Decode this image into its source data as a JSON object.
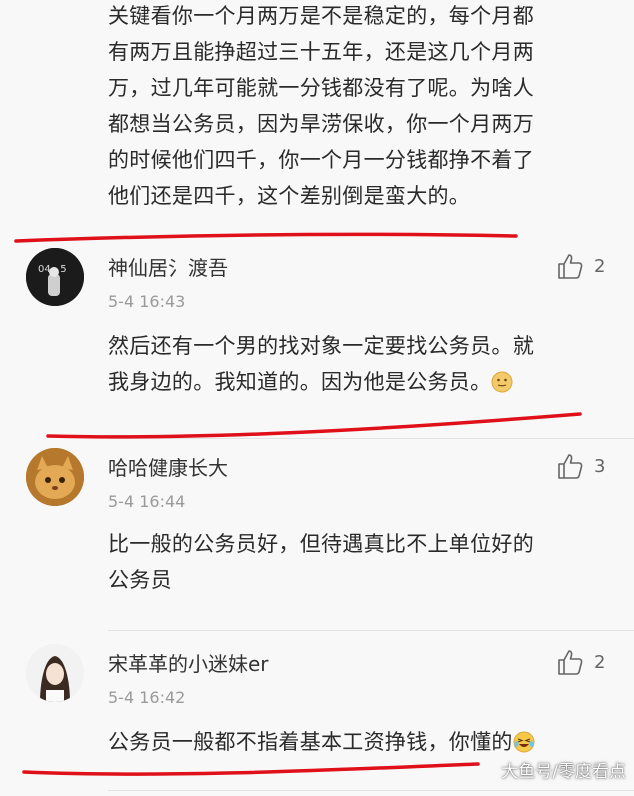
{
  "prev_comment": {
    "lines": [
      "关键看你一个月两万是不是稳定的，每个月都",
      "有两万且能挣超过三十五年，还是这几个月两",
      "万，过几年可能就一分钱都没有了呢。为啥人",
      "都想当公务员，因为旱涝保收，你一个月两万",
      "的时候他们四千，你一个月一分钱都挣不着了",
      "他们还是四千，这个差别倒是蛮大的。"
    ]
  },
  "comments": [
    {
      "username": "神仙居氵渡吾",
      "time": "5-4 16:43",
      "likes": "2",
      "lines": [
        "然后还有一个男的找对象一定要找公务员。就",
        "我身边的。我知道的。因为他是公务员。"
      ],
      "avatar_icon": "dark-photo-avatar",
      "emoji_icon": "smile-emoji-icon"
    },
    {
      "username": "哈哈健康长大",
      "time": "5-4 16:44",
      "likes": "3",
      "lines": [
        "比一般的公务员好，但待遇真比不上单位好的",
        "公务员"
      ],
      "avatar_icon": "cat-avatar"
    },
    {
      "username": "宋革革的小迷妹er",
      "time": "5-4 16:42",
      "likes": "2",
      "lines": [
        "公务员一般都不指着基本工资挣钱，你懂的"
      ],
      "avatar_icon": "girl-avatar",
      "emoji_icon": "laugh-cry-emoji-icon"
    }
  ],
  "watermark": "大鱼号/零度看点",
  "colors": {
    "background": "#f8f8f8",
    "underline": "#e0101a",
    "time": "#9a9a9a"
  }
}
